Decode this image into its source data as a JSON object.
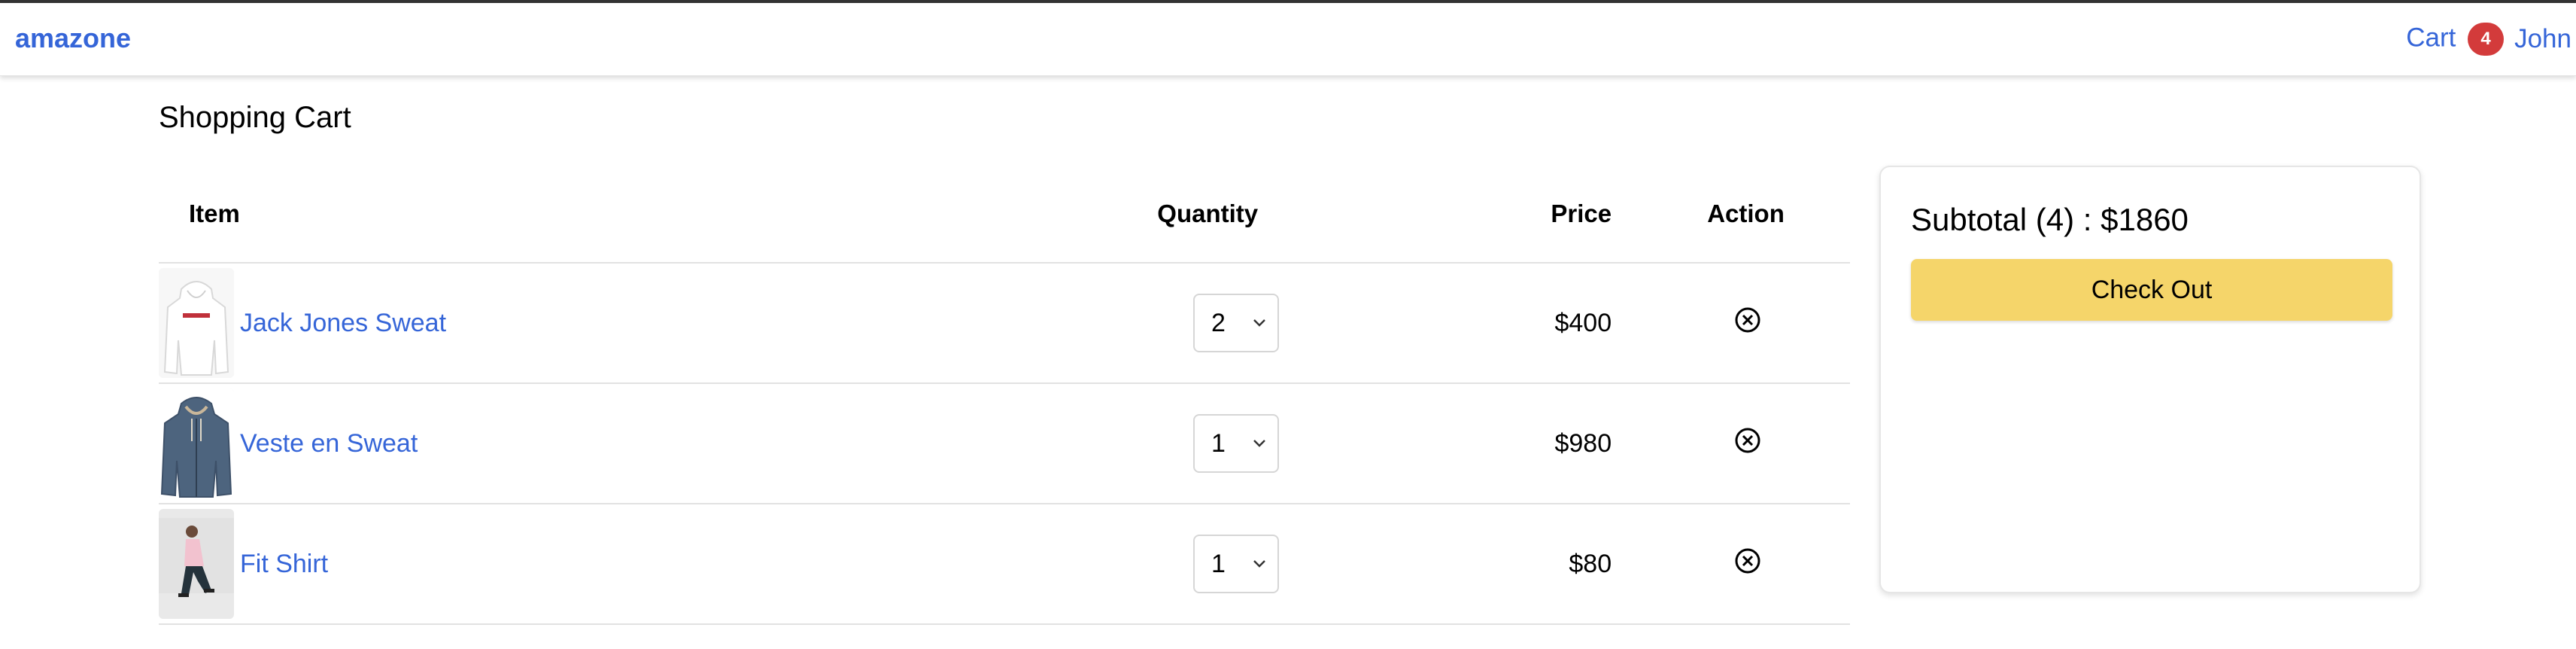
{
  "navbar": {
    "brand": "amazone",
    "cart_label": "Cart",
    "cart_count": "4",
    "user_label": "John"
  },
  "page": {
    "title": "Shopping Cart"
  },
  "table": {
    "headers": {
      "item": "Item",
      "quantity": "Quantity",
      "price": "Price",
      "action": "Action"
    },
    "rows": [
      {
        "name": "Jack Jones Sweat",
        "quantity": "2",
        "price": "$400",
        "image": "white-hoodie"
      },
      {
        "name": "Veste en Sweat",
        "quantity": "1",
        "price": "$980",
        "image": "blue-hoodie"
      },
      {
        "name": "Fit Shirt",
        "quantity": "1",
        "price": "$80",
        "image": "model-photo"
      }
    ]
  },
  "summary": {
    "subtotal": "Subtotal (4) : $1860",
    "checkout_label": "Check Out"
  },
  "colors": {
    "accent": "#3565d8",
    "badge": "#d33b3b",
    "checkout": "#f5d56a"
  },
  "icons": {
    "remove": "circle-x-icon",
    "dropdown": "chevron-down-icon"
  }
}
